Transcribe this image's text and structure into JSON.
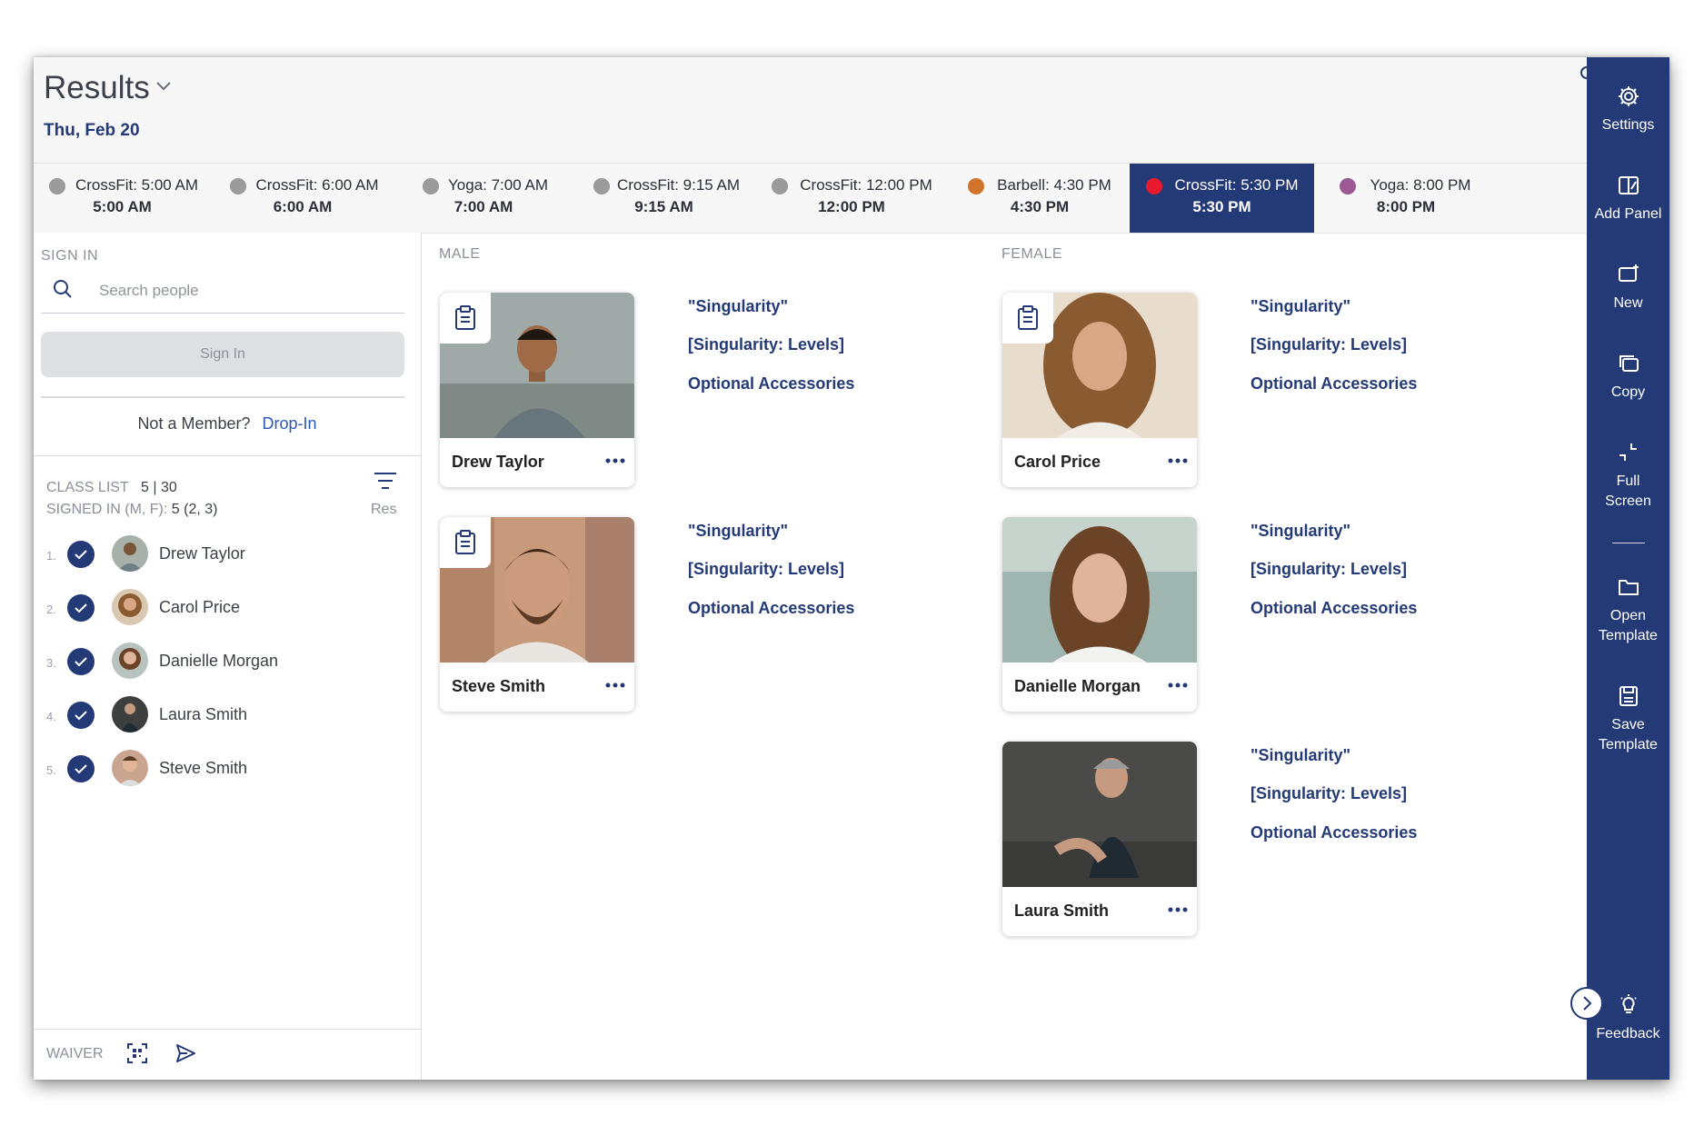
{
  "header": {
    "title": "Results",
    "date": "Thu, Feb 20"
  },
  "classes": [
    {
      "name": "CrossFit: 5:00 AM",
      "time": "5:00 AM",
      "color": "#9b9b9b",
      "active": false
    },
    {
      "name": "CrossFit: 6:00 AM",
      "time": "6:00 AM",
      "color": "#9b9b9b",
      "active": false
    },
    {
      "name": "Yoga: 7:00 AM",
      "time": "7:00 AM",
      "color": "#9b9b9b",
      "active": false
    },
    {
      "name": "CrossFit: 9:15 AM",
      "time": "9:15 AM",
      "color": "#9b9b9b",
      "active": false
    },
    {
      "name": "CrossFit: 12:00 PM",
      "time": "12:00 PM",
      "color": "#9b9b9b",
      "active": false
    },
    {
      "name": "Barbell: 4:30 PM",
      "time": "4:30 PM",
      "color": "#d2732c",
      "active": false
    },
    {
      "name": "CrossFit: 5:30 PM",
      "time": "5:30 PM",
      "color": "#e8192c",
      "active": true
    },
    {
      "name": "Yoga: 8:00 PM",
      "time": "8:00 PM",
      "color": "#9c5a93",
      "active": false
    }
  ],
  "sign_in": {
    "label": "SIGN IN",
    "search_placeholder": "Search people",
    "button": "Sign In",
    "not_member": "Not a Member?",
    "dropin": "Drop-In"
  },
  "class_list": {
    "label": "CLASS LIST",
    "count": "5 | 30",
    "signed_label": "SIGNED IN (M, F):",
    "signed_value": "5 (2, 3)",
    "res": "Res",
    "members": [
      {
        "num": "1.",
        "name": "Drew Taylor"
      },
      {
        "num": "2.",
        "name": "Carol Price"
      },
      {
        "num": "3.",
        "name": "Danielle Morgan"
      },
      {
        "num": "4.",
        "name": "Laura Smith"
      },
      {
        "num": "5.",
        "name": "Steve Smith"
      }
    ]
  },
  "footer": {
    "waiver": "WAIVER"
  },
  "columns": {
    "male": "MALE",
    "female": "FEMALE"
  },
  "cards": {
    "male": [
      {
        "name": "Drew Taylor",
        "attr1": "\"Singularity\"",
        "attr2": "[Singularity: Levels]",
        "attr3": "Optional Accessories"
      },
      {
        "name": "Steve Smith",
        "attr1": "\"Singularity\"",
        "attr2": "[Singularity: Levels]",
        "attr3": "Optional Accessories"
      }
    ],
    "female": [
      {
        "name": "Carol Price",
        "attr1": "\"Singularity\"",
        "attr2": "[Singularity: Levels]",
        "attr3": "Optional Accessories"
      },
      {
        "name": "Danielle Morgan",
        "attr1": "\"Singularity\"",
        "attr2": "[Singularity: Levels]",
        "attr3": "Optional Accessories"
      },
      {
        "name": "Laura Smith",
        "attr1": "\"Singularity\"",
        "attr2": "[Singularity: Levels]",
        "attr3": "Optional Accessories"
      }
    ]
  },
  "sidebar": {
    "settings": "Settings",
    "add_panel": "Add Panel",
    "new": "New",
    "copy": "Copy",
    "full_screen_1": "Full",
    "full_screen_2": "Screen",
    "open_template_1": "Open",
    "open_template_2": "Template",
    "save_template_1": "Save",
    "save_template_2": "Template",
    "feedback": "Feedback"
  },
  "colors": {
    "accent": "#243a77",
    "link": "#2a57b7"
  }
}
